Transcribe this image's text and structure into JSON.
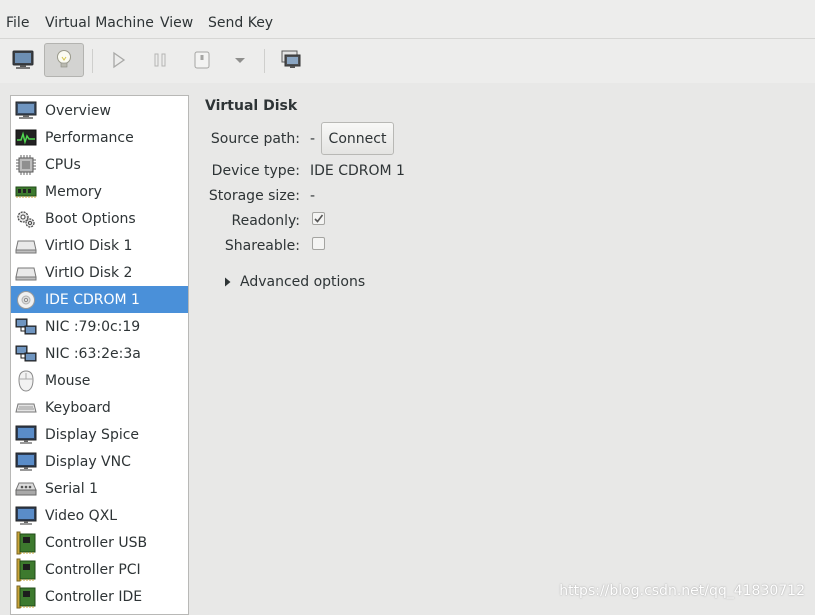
{
  "menu": [
    "File",
    "Virtual Machine",
    "View",
    "Send Key"
  ],
  "toolbar": {
    "buttons": [
      "console-button",
      "details-button",
      "run-button",
      "pause-button",
      "shutdown-button",
      "shutdown-menu-button",
      "snapshots-button"
    ]
  },
  "sidebar": {
    "selected_index": 7,
    "items": [
      {
        "label": "Overview",
        "icon": "monitor-icon"
      },
      {
        "label": "Performance",
        "icon": "performance-graph-icon"
      },
      {
        "label": "CPUs",
        "icon": "cpu-chip-icon"
      },
      {
        "label": "Memory",
        "icon": "memory-module-icon"
      },
      {
        "label": "Boot Options",
        "icon": "gears-icon"
      },
      {
        "label": "VirtIO Disk 1",
        "icon": "hard-disk-icon"
      },
      {
        "label": "VirtIO Disk 2",
        "icon": "hard-disk-icon"
      },
      {
        "label": "IDE CDROM 1",
        "icon": "cdrom-disc-icon"
      },
      {
        "label": "NIC :79:0c:19",
        "icon": "network-icon"
      },
      {
        "label": "NIC :63:2e:3a",
        "icon": "network-icon"
      },
      {
        "label": "Mouse",
        "icon": "mouse-icon"
      },
      {
        "label": "Keyboard",
        "icon": "keyboard-icon"
      },
      {
        "label": "Display Spice",
        "icon": "display-icon"
      },
      {
        "label": "Display VNC",
        "icon": "display-icon"
      },
      {
        "label": "Serial 1",
        "icon": "serial-port-icon"
      },
      {
        "label": "Video QXL",
        "icon": "display-icon"
      },
      {
        "label": "Controller USB",
        "icon": "controller-card-icon"
      },
      {
        "label": "Controller PCI",
        "icon": "controller-card-icon"
      },
      {
        "label": "Controller IDE",
        "icon": "controller-card-icon"
      }
    ]
  },
  "detail": {
    "section_title": "Virtual Disk",
    "source_path_label": "Source path:",
    "source_path_value": "-",
    "connect_label": "Connect",
    "device_type_label": "Device type:",
    "device_type_value": "IDE CDROM 1",
    "storage_size_label": "Storage size:",
    "storage_size_value": "-",
    "readonly_label": "Readonly:",
    "readonly_checked": true,
    "shareable_label": "Shareable:",
    "shareable_checked": false,
    "advanced_label": "Advanced options"
  },
  "watermark": "https://blog.csdn.net/qq_41830712",
  "colors": {
    "selection": "#4a90d9",
    "window_bg": "#e8e8e7"
  }
}
